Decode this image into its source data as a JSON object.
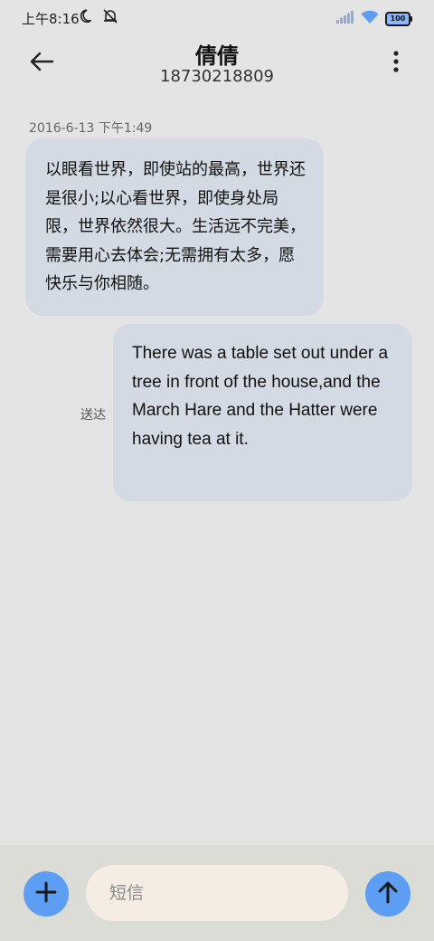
{
  "status_bar": {
    "time": "上午8:16",
    "left_icons": [
      "moon-icon",
      "muted-bell-icon"
    ],
    "right_icons": [
      "signal-icon",
      "wifi-icon",
      "battery-icon"
    ],
    "battery_level": "100"
  },
  "header": {
    "back_icon": "back-arrow-icon",
    "contact_name": "倩倩",
    "phone_number": "18730218809",
    "more_icon": "more-vertical-icon"
  },
  "conversation": {
    "timestamp": "2016-6-13 下午1:49",
    "messages": [
      {
        "direction": "incoming",
        "text": "以眼看世界，即使站的最高，世界还是很小;以心看世界，即使身处局限，世界依然很大。生活远不完美，需要用心去体会;无需拥有太多，愿快乐与你相随。"
      },
      {
        "direction": "outgoing",
        "text": "There was a table set out under a tree in front of the house,and the March Hare and the Hatter were having tea at it.",
        "status": "送达"
      }
    ]
  },
  "composer": {
    "add_icon": "plus-icon",
    "input_value": "",
    "input_placeholder": "短信",
    "send_icon": "arrow-up-icon"
  },
  "colors": {
    "background": "#e4e4e4",
    "bubble": "#d3dae3",
    "accent": "#5d9ef5",
    "input_background": "#f5ede4"
  }
}
